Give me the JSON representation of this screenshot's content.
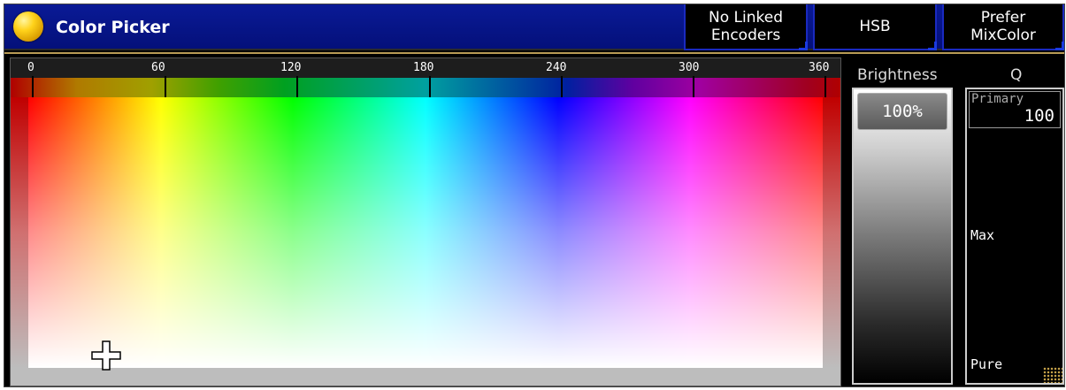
{
  "window": {
    "title": "Color Picker",
    "buttons": {
      "encoders_line1": "No Linked",
      "encoders_line2": "Encoders",
      "mode": "HSB",
      "prefer_line1": "Prefer",
      "prefer_line2": "MixColor"
    }
  },
  "hue_ruler": {
    "ticks": [
      "0",
      "60",
      "120",
      "180",
      "240",
      "300",
      "360"
    ]
  },
  "brightness": {
    "label": "Brightness",
    "value_text": "100%",
    "value": 100
  },
  "quality": {
    "label": "Q",
    "knob_caption": "Primary",
    "knob_value": "100",
    "level_labels": {
      "max": "Max",
      "pure": "Pure"
    }
  },
  "colors": {
    "titlebar": "#04107a",
    "button_border": "#1a2ac0",
    "frame_accent": "#b89a55"
  }
}
